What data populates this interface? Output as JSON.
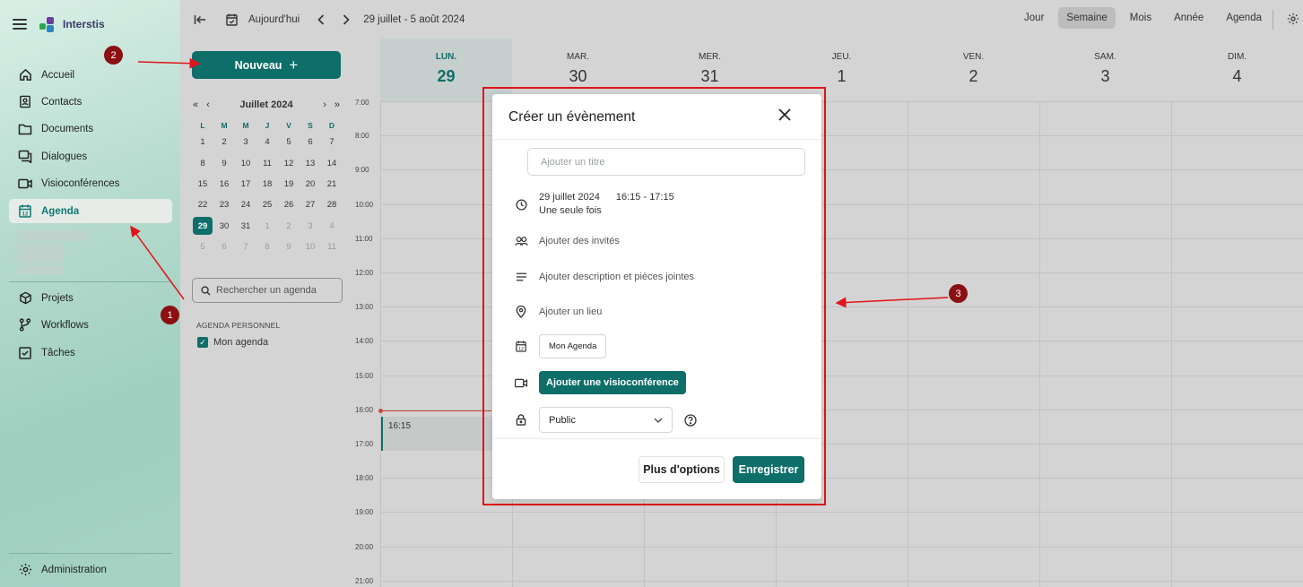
{
  "app": {
    "name": "Interstis"
  },
  "nav": {
    "items": [
      {
        "label": "Accueil",
        "icon": "home-icon"
      },
      {
        "label": "Contacts",
        "icon": "contacts-icon"
      },
      {
        "label": "Documents",
        "icon": "folder-icon"
      },
      {
        "label": "Dialogues",
        "icon": "chat-icon"
      },
      {
        "label": "Visioconférences",
        "icon": "video-icon"
      },
      {
        "label": "Agenda",
        "icon": "calendar-icon",
        "active": true
      },
      {
        "label": "Projets",
        "icon": "cube-icon"
      },
      {
        "label": "Workflows",
        "icon": "workflow-icon"
      },
      {
        "label": "Tâches",
        "icon": "checkbox-icon"
      }
    ],
    "admin_label": "Administration"
  },
  "toolbar": {
    "today_label": "Aujourd'hui",
    "range_label": "29 juillet - 5 août 2024",
    "views": [
      "Jour",
      "Semaine",
      "Mois",
      "Année",
      "Agenda"
    ],
    "selected_view": "Semaine"
  },
  "side": {
    "new_label": "Nouveau",
    "month_label": "Juillet 2024",
    "weekday_letters": [
      "L",
      "M",
      "M",
      "J",
      "V",
      "S",
      "D"
    ],
    "weeks": [
      [
        "1",
        "2",
        "3",
        "4",
        "5",
        "6",
        "7"
      ],
      [
        "8",
        "9",
        "10",
        "11",
        "12",
        "13",
        "14"
      ],
      [
        "15",
        "16",
        "17",
        "18",
        "19",
        "20",
        "21"
      ],
      [
        "22",
        "23",
        "24",
        "25",
        "26",
        "27",
        "28"
      ],
      [
        "29",
        "30",
        "31",
        "1",
        "2",
        "3",
        "4"
      ],
      [
        "5",
        "6",
        "7",
        "8",
        "9",
        "10",
        "11"
      ]
    ],
    "search_placeholder": "Rechercher un agenda",
    "personal_header": "AGENDA PERSONNEL",
    "personal_agenda": "Mon agenda"
  },
  "week": {
    "days": [
      {
        "name": "LUN.",
        "date": "29",
        "today": true
      },
      {
        "name": "MAR.",
        "date": "30"
      },
      {
        "name": "MER.",
        "date": "31"
      },
      {
        "name": "JEU.",
        "date": "1"
      },
      {
        "name": "VEN.",
        "date": "2"
      },
      {
        "name": "SAM.",
        "date": "3"
      },
      {
        "name": "DIM.",
        "date": "4"
      }
    ],
    "hours": [
      "7:00",
      "8:00",
      "9:00",
      "10:00",
      "11:00",
      "12:00",
      "13:00",
      "14:00",
      "15:00",
      "16:00",
      "17:00",
      "18:00",
      "19:00",
      "20:00",
      "21:00"
    ],
    "event_label": "16:15"
  },
  "modal": {
    "title": "Créer un évènement",
    "title_placeholder": "Ajouter un titre",
    "date": "29 juillet 2024",
    "time": "16:15 - 17:15",
    "recurrence": "Une seule fois",
    "guests": "Ajouter des invités",
    "description": "Ajouter description et pièces jointes",
    "location": "Ajouter un lieu",
    "calendar": "Mon Agenda",
    "visio": "Ajouter une visioconférence",
    "visibility": "Public",
    "more_options": "Plus d'options",
    "save": "Enregistrer"
  },
  "annotations": [
    "1",
    "2",
    "3"
  ],
  "colors": {
    "primary": "#0e6e69",
    "annotation": "#8c0f12",
    "frame": "#e0141a"
  }
}
